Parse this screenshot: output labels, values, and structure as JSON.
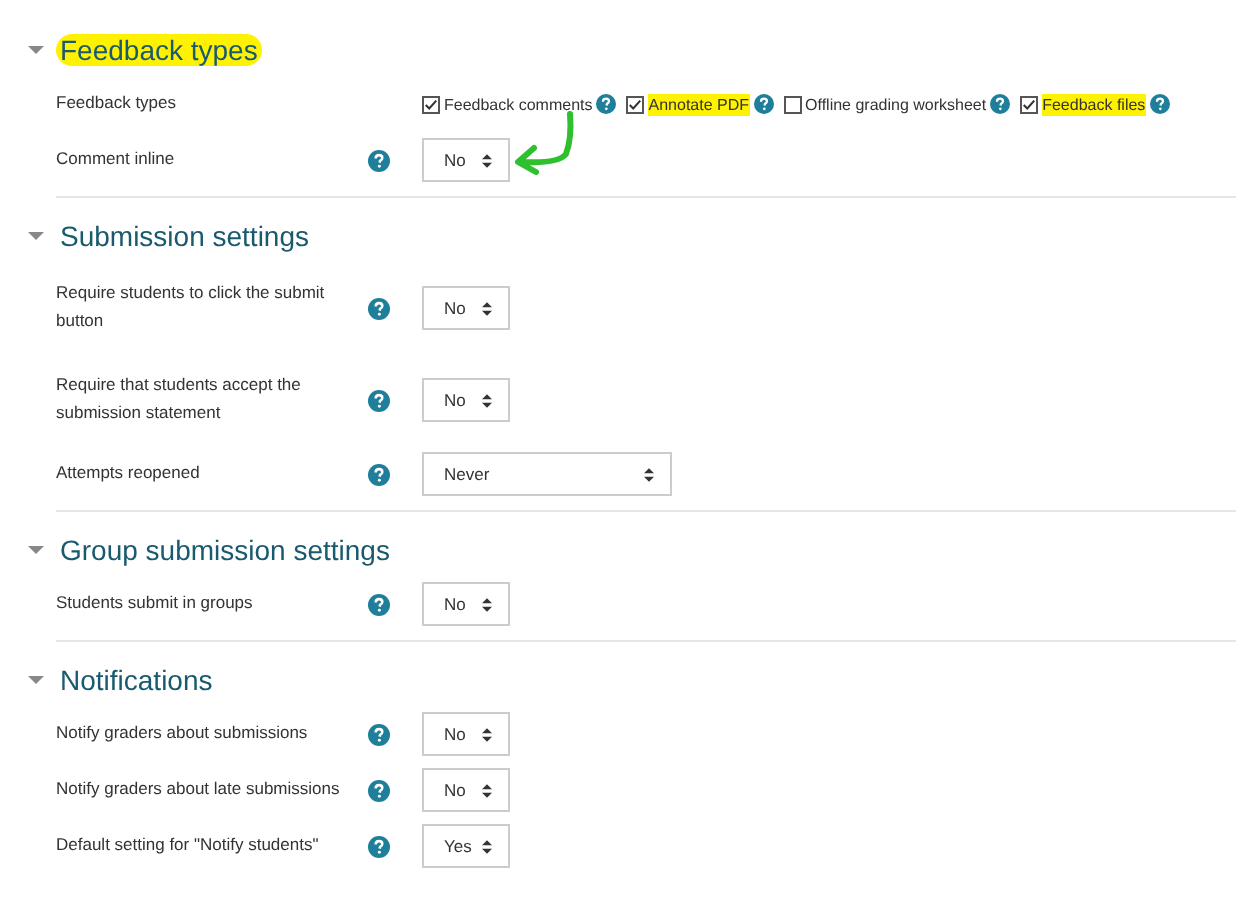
{
  "sections": [
    {
      "title": "Feedback types",
      "expanded": true,
      "highlighted": true,
      "rows": [
        {
          "label": "Feedback types",
          "kind": "checkboxes",
          "help": false,
          "options": [
            {
              "label": "Feedback comments",
              "checked": true,
              "highlighted": false
            },
            {
              "label": "Annotate PDF",
              "checked": true,
              "highlighted": true
            },
            {
              "label": "Offline grading worksheet",
              "checked": false,
              "highlighted": false
            },
            {
              "label": "Feedback files",
              "checked": true,
              "highlighted": true
            }
          ]
        },
        {
          "label": "Comment inline",
          "kind": "select",
          "help": true,
          "value": "No",
          "arrow_marked": true
        }
      ]
    },
    {
      "title": "Submission settings",
      "expanded": true,
      "highlighted": false,
      "rows": [
        {
          "label": "Require students to click the submit button",
          "kind": "select",
          "help": true,
          "value": "No",
          "arrow_marked": false
        },
        {
          "label": "Require that students accept the submission statement",
          "kind": "select",
          "help": true,
          "value": "No",
          "arrow_marked": false
        },
        {
          "label": "Attempts reopened",
          "kind": "wide-select",
          "help": true,
          "value": "Never",
          "arrow_marked": false
        }
      ]
    },
    {
      "title": "Group submission settings",
      "expanded": true,
      "highlighted": false,
      "rows": [
        {
          "label": "Students submit in groups",
          "kind": "select",
          "help": true,
          "value": "No",
          "arrow_marked": false
        }
      ]
    },
    {
      "title": "Notifications",
      "expanded": true,
      "highlighted": false,
      "rows": [
        {
          "label": "Notify graders about submissions",
          "kind": "select",
          "help": true,
          "value": "No",
          "arrow_marked": false
        },
        {
          "label": "Notify graders about late submissions",
          "kind": "select",
          "help": true,
          "value": "No",
          "arrow_marked": false
        },
        {
          "label": "Default setting for \"Notify students\"",
          "kind": "select",
          "help": true,
          "value": "Yes",
          "arrow_marked": false
        }
      ]
    }
  ]
}
